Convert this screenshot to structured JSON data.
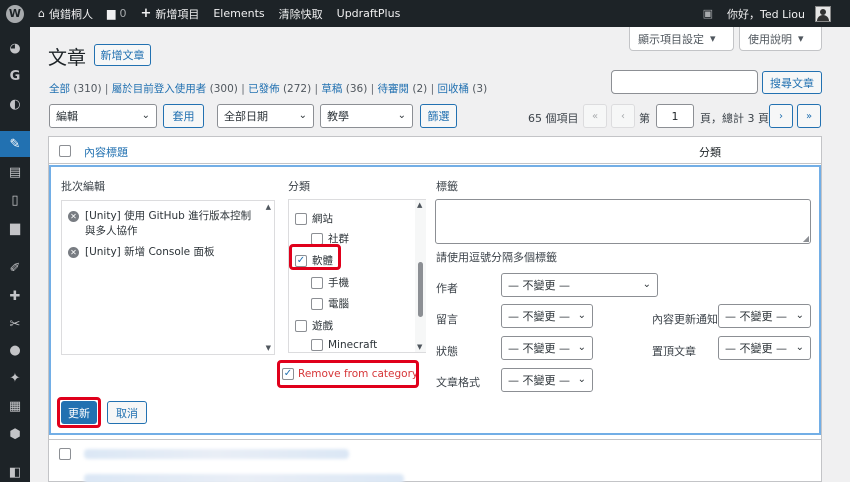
{
  "adminbar": {
    "site_name": "偵錯桐人",
    "comments_count": "0",
    "new_item": "新增項目",
    "elements": "Elements",
    "clear_cache": "清除快取",
    "updraft": "UpdraftPlus",
    "greeting": "你好，Ted Liou"
  },
  "screen_options": {
    "display": "顯示項目設定",
    "help": "使用說明"
  },
  "page": {
    "title": "文章",
    "add_new": "新增文章"
  },
  "filters": {
    "views": [
      {
        "label": "全部",
        "count": "(310)"
      },
      {
        "label": "屬於目前登入使用者",
        "count": "(300)"
      },
      {
        "label": "已發佈",
        "count": "(272)"
      },
      {
        "label": "草稿",
        "count": "(36)"
      },
      {
        "label": "待審閱",
        "count": "(2)"
      },
      {
        "label": "回收桶",
        "count": "(3)"
      }
    ],
    "search_value": "",
    "search_button": "搜尋文章",
    "bulk_action": "編輯",
    "apply": "套用",
    "date_filter": "全部日期",
    "category_filter": "教學",
    "filter_button": "篩選"
  },
  "pagination": {
    "items": "65 個項目",
    "first": "«",
    "prev": "‹",
    "page_prefix": "第",
    "current": "1",
    "page_suffix": "頁，總計 3 頁",
    "next": "›",
    "last": "»"
  },
  "table": {
    "col_title": "內容標題",
    "col_category": "分類"
  },
  "bulk_edit": {
    "heading": "批次編輯",
    "titles": [
      "[Unity] 使用 GitHub 進行版本控制與多人協作",
      "[Unity] 新增 Console 面板"
    ],
    "categories_heading": "分類",
    "categories": [
      {
        "label": "網站",
        "checked": false,
        "indent": 0
      },
      {
        "label": "社群",
        "checked": false,
        "indent": 1
      },
      {
        "label": "軟體",
        "checked": true,
        "indent": 0
      },
      {
        "label": "手機",
        "checked": false,
        "indent": 1
      },
      {
        "label": "電腦",
        "checked": false,
        "indent": 1
      },
      {
        "label": "遊戲",
        "checked": false,
        "indent": 0
      },
      {
        "label": "Minecraft",
        "checked": false,
        "indent": 1
      }
    ],
    "remove_category": "Remove from category",
    "tags_heading": "標籤",
    "tags_hint": "請使用逗號分隔多個標籤",
    "author_label": "作者",
    "author_value": "— 不變更 —",
    "comments_label": "留言",
    "comments_value": "— 不變更 —",
    "pings_label": "內容更新通知",
    "pings_value": "— 不變更 —",
    "status_label": "狀態",
    "status_value": "— 不變更 —",
    "sticky_label": "置頂文章",
    "sticky_value": "— 不變更 —",
    "format_label": "文章格式",
    "format_value": "— 不變更 —",
    "update": "更新",
    "cancel": "取消"
  },
  "colors": {
    "accent": "#2271b1",
    "highlight": "#e0001b",
    "adminbar": "#1d2327"
  }
}
